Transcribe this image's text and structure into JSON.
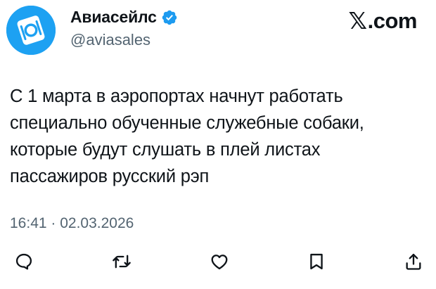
{
  "author": {
    "display_name": "Авиасейлс",
    "handle": "@aviasales",
    "verified": true,
    "avatar_icon": "aviasales-logo-icon",
    "avatar_color": "#1da1f2"
  },
  "source": {
    "mark": "𝕏",
    "label": ".com"
  },
  "tweet": {
    "lines": [
      "С 1 марта в аэропортах начнут работать",
      "специально обученные служебные собаки,",
      "которые будут слушать в плей листах",
      "пассажиров русский рэп"
    ],
    "timestamp": "16:41 · 02.03.2026"
  },
  "actions": [
    {
      "icon": "reply-icon"
    },
    {
      "icon": "retweet-icon"
    },
    {
      "icon": "like-icon"
    },
    {
      "icon": "bookmark-icon"
    },
    {
      "icon": "share-icon"
    }
  ],
  "colors": {
    "text": "#0f1419",
    "secondary": "#536471",
    "verified": "#1d9bf0"
  }
}
